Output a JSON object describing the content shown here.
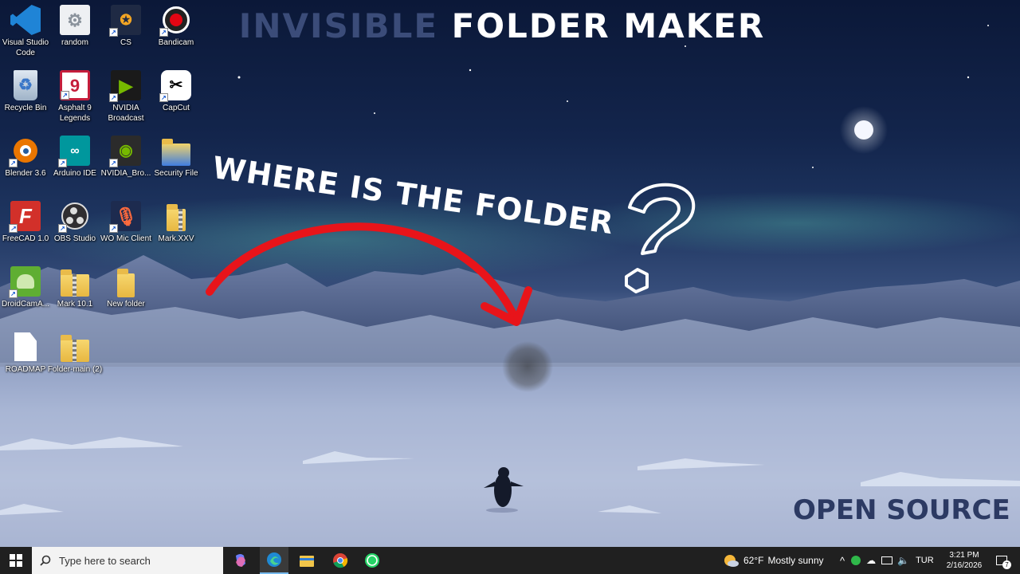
{
  "thumbnail": {
    "title_dim": "INVISIBLE",
    "title_bright": "FOLDER MAKER",
    "caption": "WHERE IS THE FOLDER",
    "footer": "OPEN SOURCE",
    "colors": {
      "arrow": "#e8141a",
      "title_dim": "#3b4c79",
      "footer": "#2c3a63"
    }
  },
  "desktop_icons": [
    {
      "label": "Visual Studio Code",
      "icon": "vscode-icon"
    },
    {
      "label": "random",
      "icon": "settings-icon"
    },
    {
      "label": "CS",
      "icon": "counter-strike-icon"
    },
    {
      "label": "Bandicam",
      "icon": "record-icon"
    },
    {
      "label": "Recycle Bin",
      "icon": "recycle-bin-icon"
    },
    {
      "label": "Asphalt 9 Legends",
      "icon": "asphalt-icon"
    },
    {
      "label": "NVIDIA Broadcast",
      "icon": "nvidia-broadcast-icon"
    },
    {
      "label": "CapCut",
      "icon": "capcut-icon"
    },
    {
      "label": "Blender 3.6",
      "icon": "blender-icon"
    },
    {
      "label": "Arduino IDE",
      "icon": "arduino-icon"
    },
    {
      "label": "NVIDIA_Bro...",
      "icon": "nvidia-icon"
    },
    {
      "label": "Security File",
      "icon": "security-folder-icon"
    },
    {
      "label": "FreeCAD 1.0",
      "icon": "freecad-icon"
    },
    {
      "label": "OBS Studio",
      "icon": "obs-icon"
    },
    {
      "label": "WO Mic Client",
      "icon": "microphone-icon"
    },
    {
      "label": "Mark.XXV",
      "icon": "folder-icon"
    },
    {
      "label": "DroidCamA...",
      "icon": "android-icon"
    },
    {
      "label": "Mark 10.1",
      "icon": "zip-folder-icon"
    },
    {
      "label": "New folder",
      "icon": "folder-icon"
    },
    {
      "label": "ROADMAP",
      "icon": "document-icon"
    },
    {
      "label": "Folder-main (2)",
      "icon": "folder-icon"
    }
  ],
  "taskbar": {
    "search_placeholder": "Type here to search",
    "weather_temp": "62°F",
    "weather_text": "Mostly sunny",
    "language": "TUR",
    "time": "3:21 PM",
    "date": "2/16/2026",
    "notification_count": "7",
    "pinned": [
      "copilot-icon",
      "edge-icon",
      "file-explorer-icon",
      "chrome-icon",
      "whatsapp-icon"
    ],
    "colors": {
      "bar": "#202020",
      "search_bg": "#f3f3f3"
    }
  }
}
